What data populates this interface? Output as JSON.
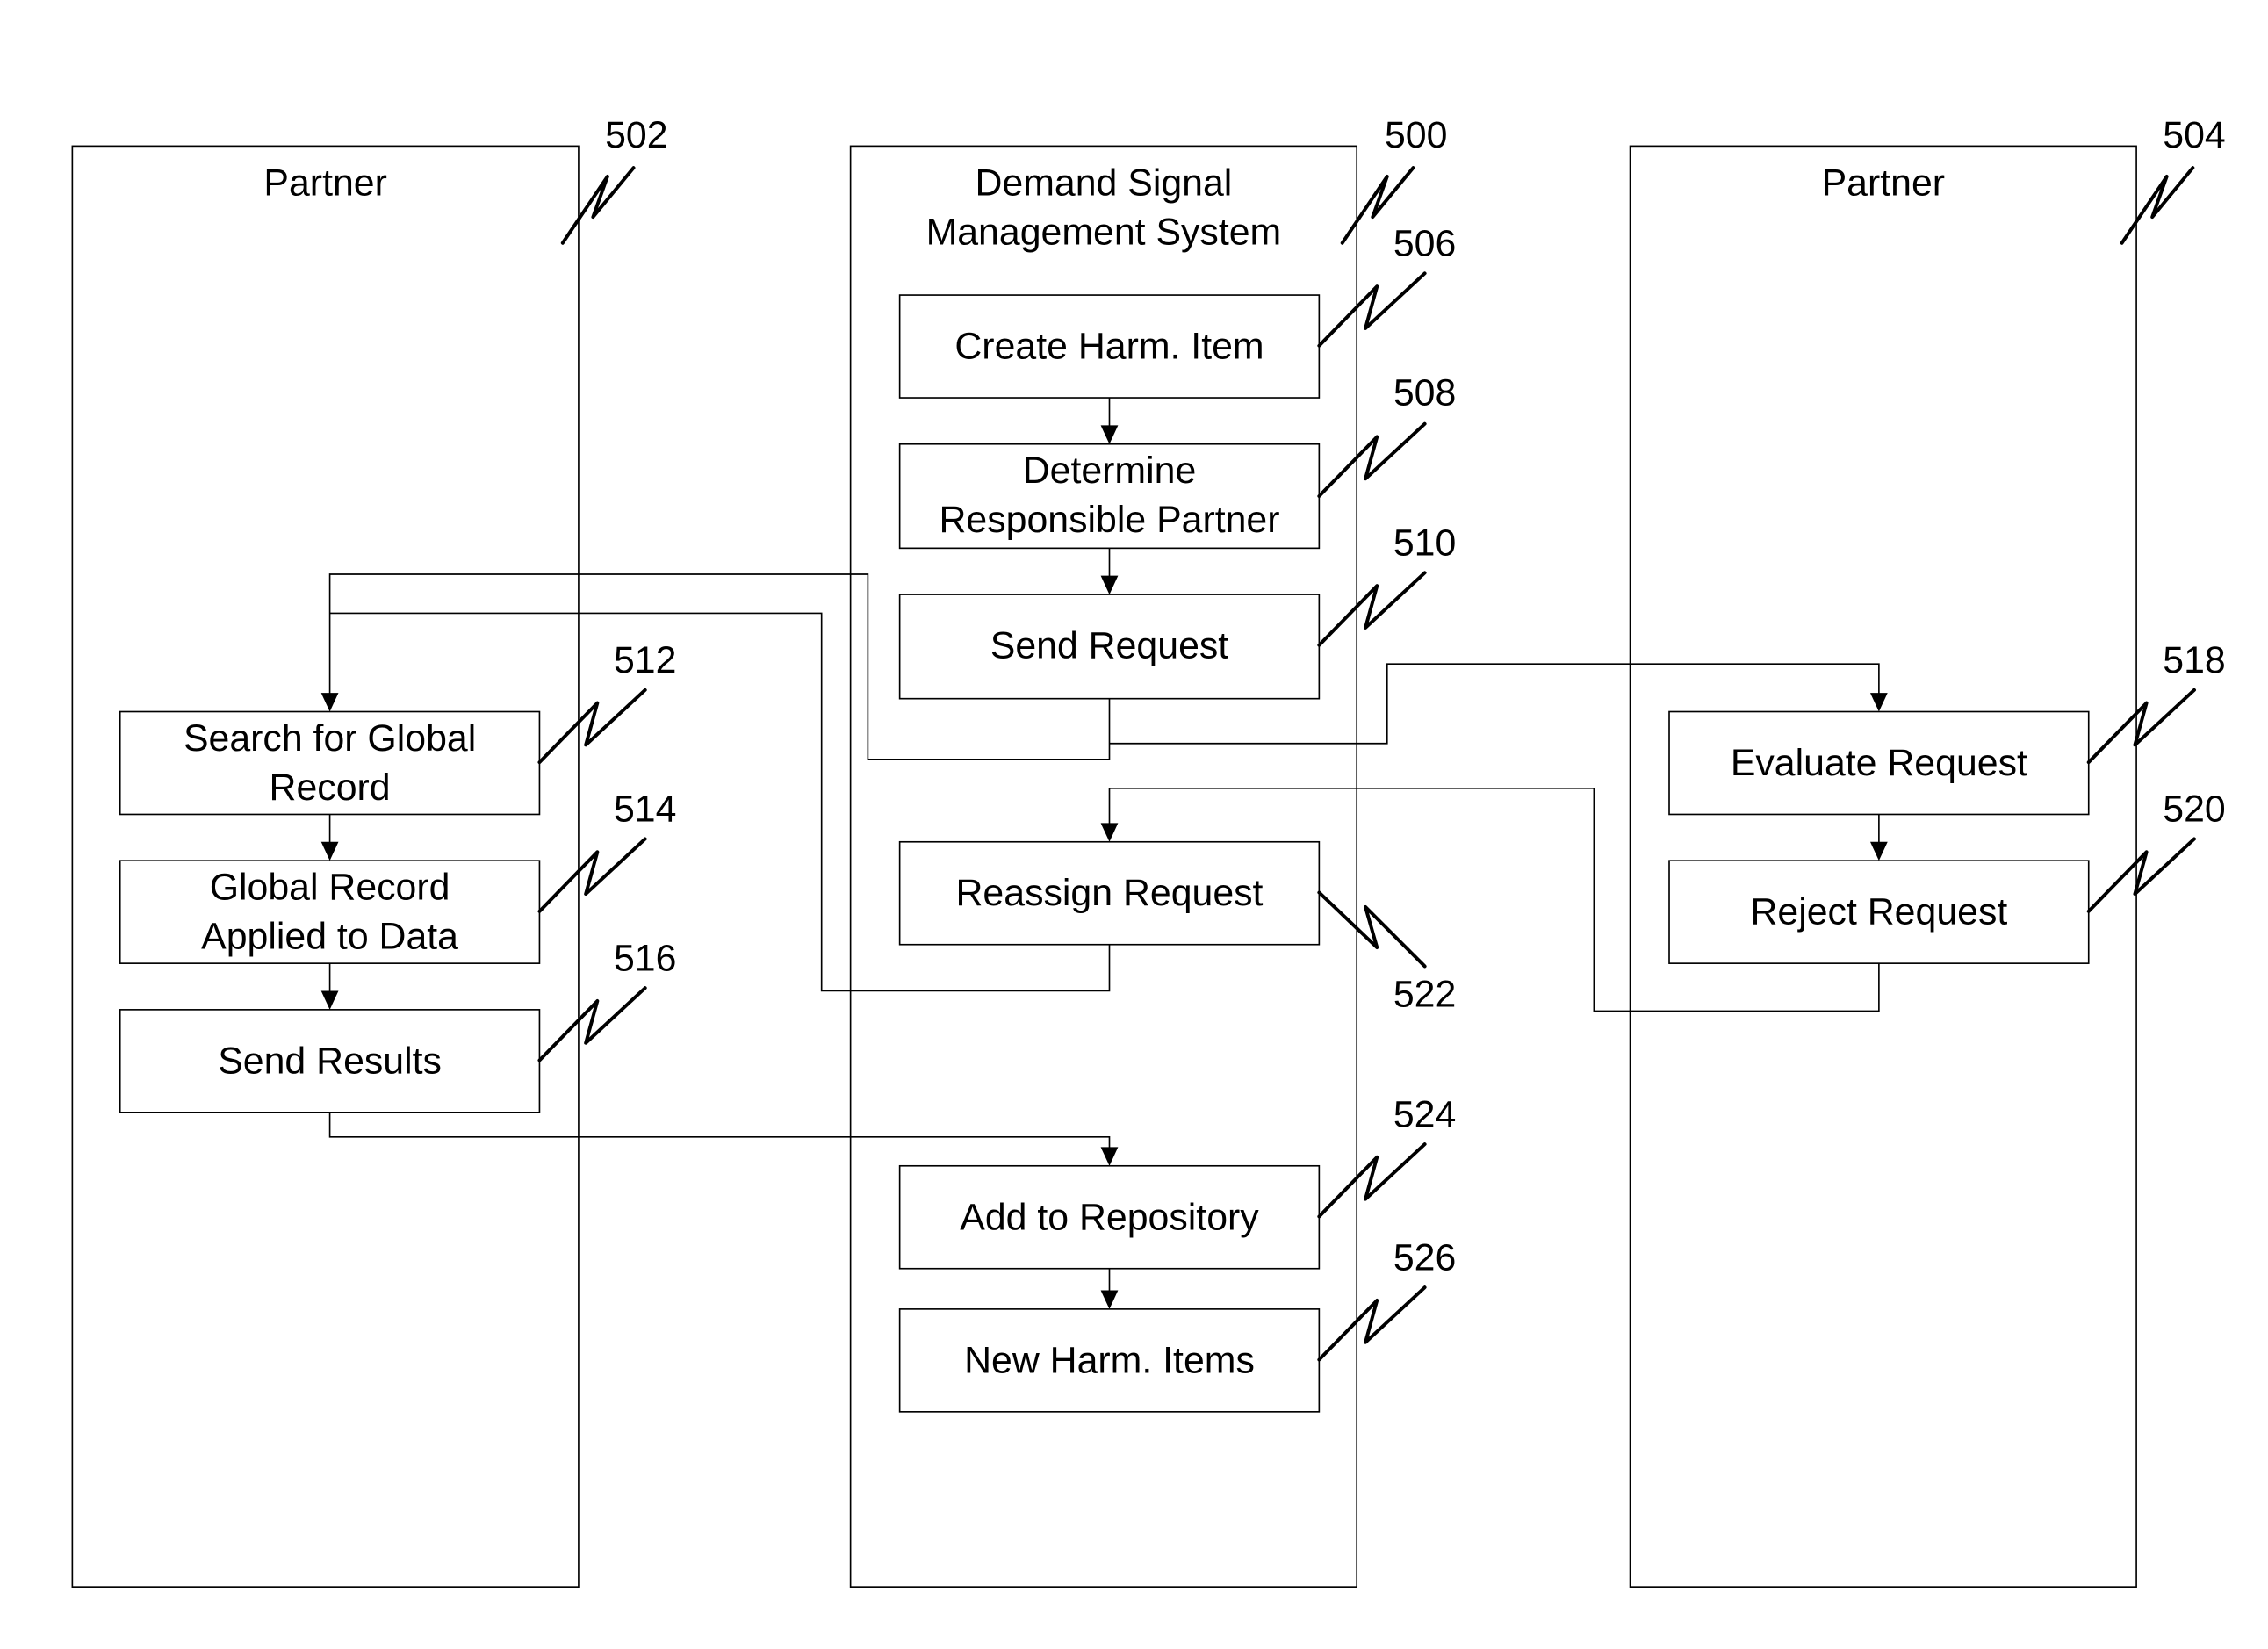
{
  "diagram": {
    "type": "swimlane-flowchart",
    "lanes": [
      {
        "id": "partner-left",
        "title": "Partner",
        "ref": "502"
      },
      {
        "id": "dsms",
        "title_lines": [
          "Demand Signal",
          "Management System"
        ],
        "ref": "500"
      },
      {
        "id": "partner-right",
        "title": "Partner",
        "ref": "504"
      }
    ],
    "steps": {
      "create": {
        "lines": [
          "Create Harm. Item"
        ],
        "ref": "506"
      },
      "determine": {
        "lines": [
          "Determine",
          "Responsible Partner"
        ],
        "ref": "508"
      },
      "send_request": {
        "lines": [
          "Send Request"
        ],
        "ref": "510"
      },
      "search": {
        "lines": [
          "Search for Global",
          "Record"
        ],
        "ref": "512"
      },
      "applied": {
        "lines": [
          "Global Record",
          "Applied to Data"
        ],
        "ref": "514"
      },
      "send_results": {
        "lines": [
          "Send Results"
        ],
        "ref": "516"
      },
      "evaluate": {
        "lines": [
          "Evaluate Request"
        ],
        "ref": "518"
      },
      "reject": {
        "lines": [
          "Reject Request"
        ],
        "ref": "520"
      },
      "reassign": {
        "lines": [
          "Reassign Request"
        ],
        "ref": "522"
      },
      "add_repo": {
        "lines": [
          "Add to Repository"
        ],
        "ref": "524"
      },
      "new_items": {
        "lines": [
          "New Harm. Items"
        ],
        "ref": "526"
      }
    },
    "flows": [
      {
        "from": "create",
        "to": "determine"
      },
      {
        "from": "determine",
        "to": "send_request"
      },
      {
        "from": "send_request",
        "to": "search"
      },
      {
        "from": "send_request",
        "to": "evaluate"
      },
      {
        "from": "evaluate",
        "to": "reject"
      },
      {
        "from": "reject",
        "to": "reassign"
      },
      {
        "from": "reassign",
        "to": "search"
      },
      {
        "from": "search",
        "to": "applied"
      },
      {
        "from": "applied",
        "to": "send_results"
      },
      {
        "from": "send_results",
        "to": "add_repo"
      },
      {
        "from": "add_repo",
        "to": "new_items"
      }
    ]
  }
}
